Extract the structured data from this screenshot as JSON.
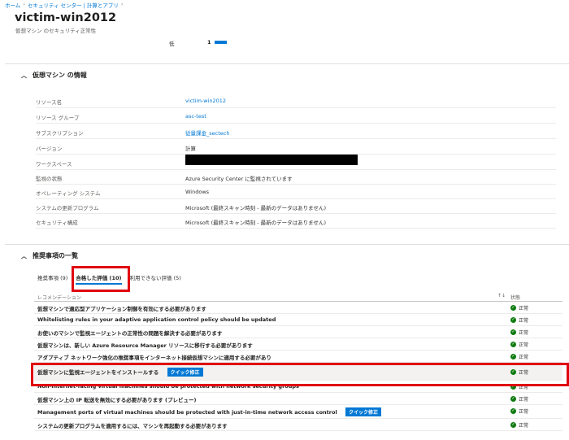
{
  "breadcrumb": [
    "ホーム",
    "セキュリティ センター | 計算とアプリ"
  ],
  "header": {
    "title": "victim-win2012",
    "subtitle": "仮想マシン のセキュリティ正常性"
  },
  "severity": {
    "label": "低",
    "count": "1"
  },
  "vm_info": {
    "heading": "仮想マシン の情報",
    "rows": [
      {
        "key": "リソース名",
        "value": "victim-win2012"
      },
      {
        "key": "リソース グループ",
        "value": "asc-test"
      },
      {
        "key": "サブスクリプション",
        "value": "従量課金_sectech"
      },
      {
        "key": "バージョン",
        "value": "計算"
      },
      {
        "key": "ワークスペース",
        "value": ""
      },
      {
        "key": "監視の状態",
        "value": "Azure Security Center に監視されています"
      },
      {
        "key": "オペレーティング システム",
        "value": "Windows"
      },
      {
        "key": "システムの更新プログラム",
        "value": "Microsoft (最終スキャン時刻 - 最新のデータはありません)"
      },
      {
        "key": "セキュリティ構成",
        "value": "Microsoft (最終スキャン時刻 - 最新のデータはありません)"
      }
    ]
  },
  "recommendations": {
    "heading": "推奨事項の一覧",
    "tabs": [
      "推奨事項 (9)",
      "合格した評価 (10)",
      "利用できない評価 (5)"
    ],
    "columns": {
      "recommendation": "レコメンデーション",
      "sort_icon": "↑↓",
      "state": "状態"
    },
    "quick_fix_label": "クイック修正",
    "status_label": "正常",
    "rows": [
      {
        "text": "仮想マシンで適応型アプリケーション制御を有効にする必要があります"
      },
      {
        "text": "Whitelisting rules in your adaptive application control policy should be updated"
      },
      {
        "text": "お使いのマシンで監視エージェントの正常性の問題を解決する必要があります"
      },
      {
        "text": "仮想マシンは、新しい Azure Resource Manager リソースに移行する必要があります"
      },
      {
        "text": "アダプティブ ネットワーク強化の推奨事項をインターネット接続仮想マシンに適用する必要があり"
      },
      {
        "text": "仮想マシンに監視エージェントをインストールする"
      },
      {
        "text": "Non-internet-facing virtual machines should be protected with network security groups"
      },
      {
        "text": "仮想マシン上の IP 転送を無効にする必要があります (プレビュー)"
      },
      {
        "text": "Management ports of virtual machines should be protected with just-in-time network access control"
      },
      {
        "text": "システムの更新プログラムを適用するには、マシンを再起動する必要があります"
      }
    ]
  },
  "colors": {
    "accent": "#0078d4",
    "highlight": "#e00010",
    "ok": "#107c10"
  }
}
